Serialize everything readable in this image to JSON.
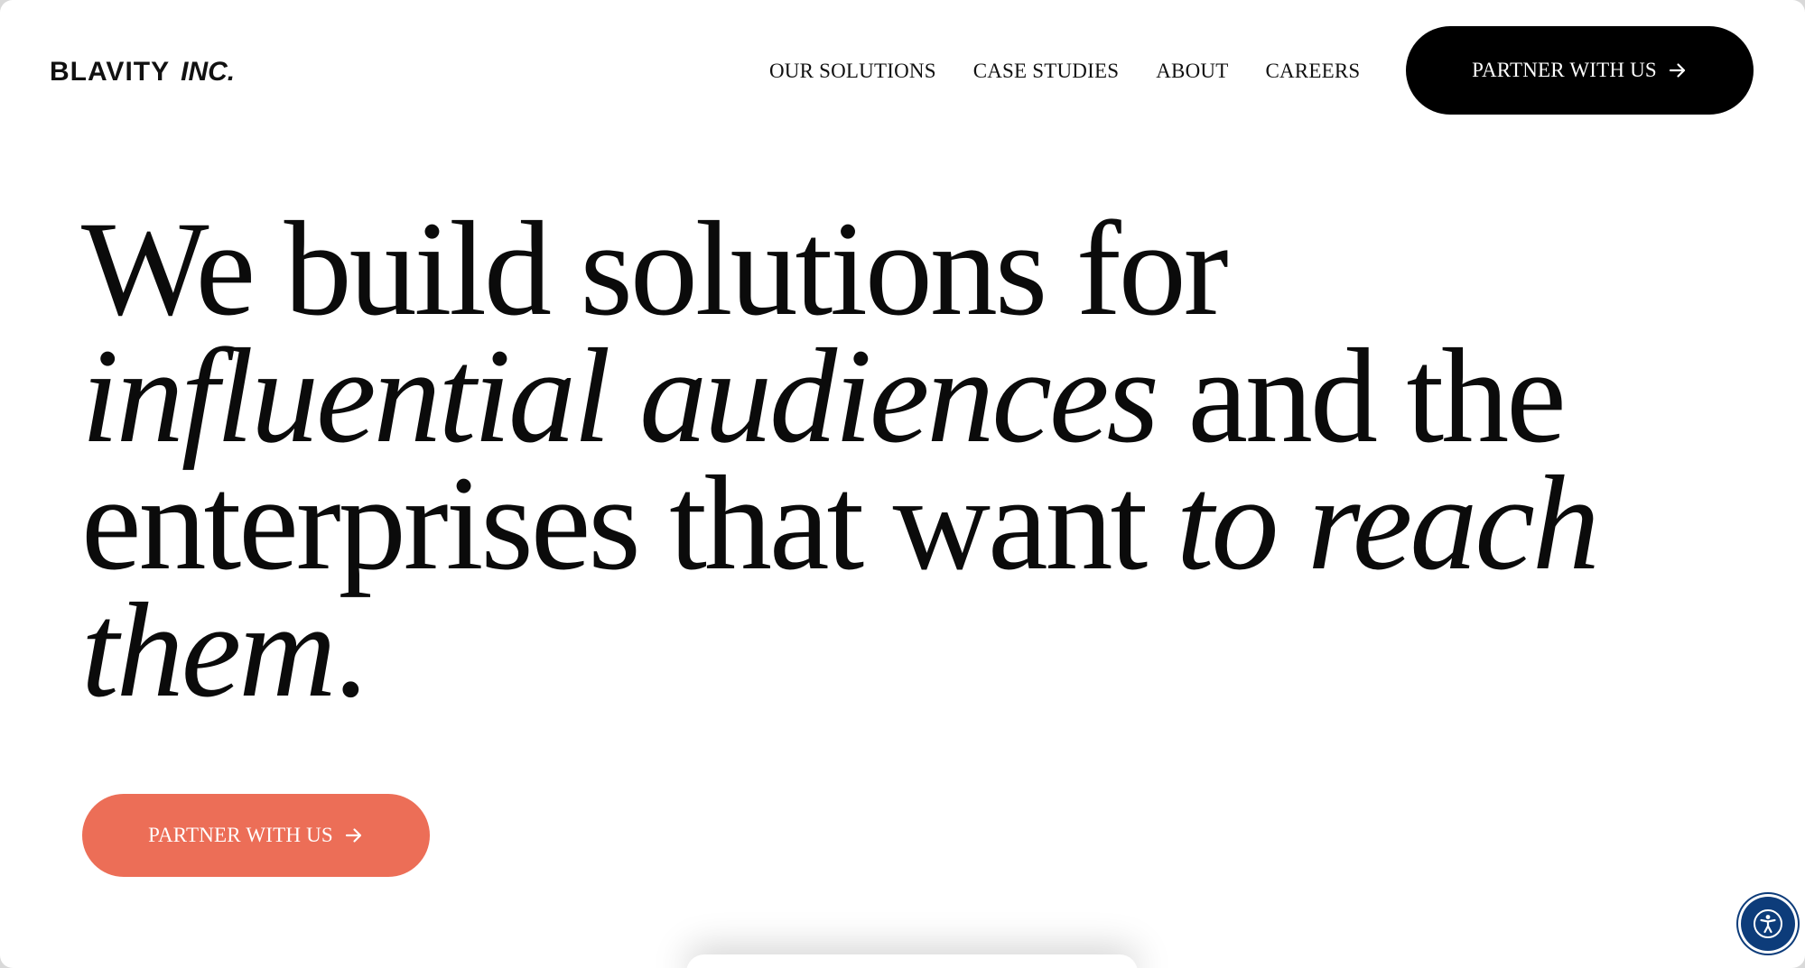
{
  "colors": {
    "background": "#ffffff",
    "text": "#0b0b0b",
    "header_button_bg": "#000000",
    "hero_button_bg": "#ec6e57",
    "accessibility_bg": "#0d3c7a"
  },
  "header": {
    "logo": {
      "name": "BLAVITY",
      "suffix": "INC."
    },
    "nav": [
      {
        "label": "OUR SOLUTIONS"
      },
      {
        "label": "CASE STUDIES"
      },
      {
        "label": "ABOUT"
      },
      {
        "label": "CAREERS"
      }
    ],
    "cta": {
      "label": "PARTNER WITH US",
      "icon": "arrow-right-icon"
    }
  },
  "hero": {
    "line1": "We build solutions for",
    "line2_italic": "influential audiences",
    "line2_rest": " and the",
    "line3_plain": "enterprises that want ",
    "line3_italic": "to reach",
    "line4_italic": "them",
    "line4_end": ".",
    "cta": {
      "label": "PARTNER WITH US",
      "icon": "arrow-right-icon"
    }
  },
  "accessibility": {
    "icon": "accessibility-icon"
  }
}
